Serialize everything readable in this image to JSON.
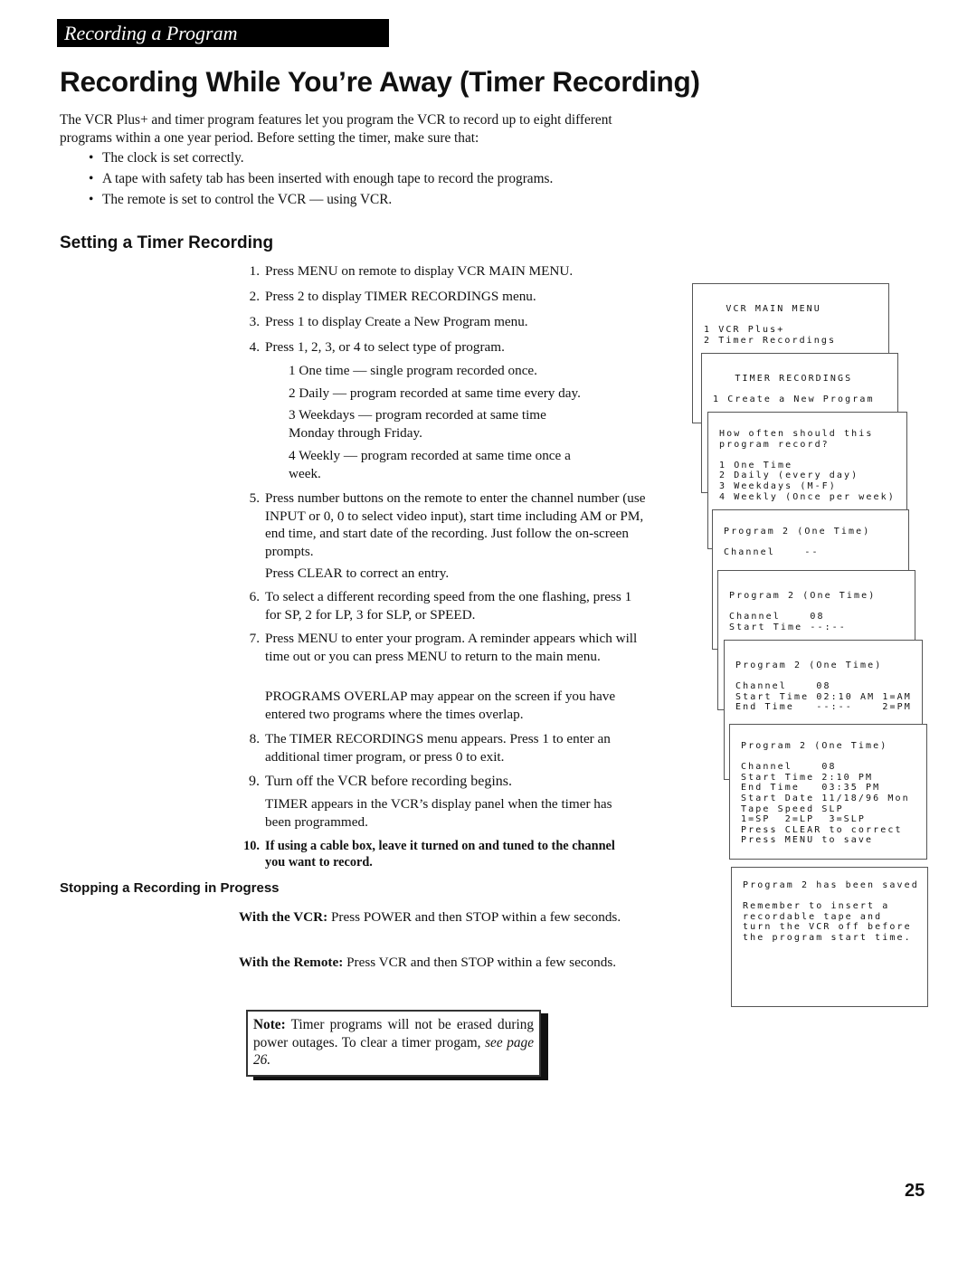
{
  "header": {
    "section": "Recording a Program",
    "title": "Recording While You’re Away (Timer Recording)"
  },
  "intro": {
    "text": "The VCR Plus+ and timer program features let you program the VCR to record up to eight different programs within a one year period.  Before setting the timer, make sure that:",
    "bullets": [
      "The clock is set correctly.",
      "A tape with safety tab has been inserted with enough tape to record the programs.",
      "The remote is set to control the VCR — using VCR."
    ]
  },
  "setting": {
    "heading": "Setting a Timer Recording",
    "steps": [
      {
        "n": "1.",
        "text": "Press MENU on remote to display VCR MAIN MENU."
      },
      {
        "n": "2.",
        "text": "Press 2 to display TIMER RECORDINGS menu."
      },
      {
        "n": "3.",
        "text": "Press 1 to display Create a New Program menu."
      },
      {
        "n": "4.",
        "text": "Press 1, 2, 3, or 4 to select type of program."
      },
      {
        "n": "5.",
        "text": "Press number buttons on the remote to enter the channel number (use INPUT or 0, 0 to select video input), start time including AM or PM, end time, and start date of the recording.  Just follow the on-screen prompts."
      },
      {
        "n": "6.",
        "text": "To select a different recording speed from the one flashing, press 1 for SP, 2 for LP, 3 for SLP, or SPEED."
      },
      {
        "n": "7.",
        "text": "Press MENU to enter your program.  A reminder appears which will time out or you can press MENU to return to the main menu."
      },
      {
        "n": "8.",
        "text": "The TIMER RECORDINGS menu appears.  Press 1 to enter an additional timer program, or press 0 to exit."
      },
      {
        "n": "9.",
        "text": "Turn off the VCR before recording begins."
      },
      {
        "n": "10.",
        "text": "If using a cable box, leave it turned on and tuned to the channel you want to record."
      }
    ],
    "types": [
      "1 One time — single program recorded once.",
      "2 Daily — program recorded at same time every day.",
      "3 Weekdays — program recorded at same time Monday through Friday.",
      "4 Weekly — program recorded at same time once a week."
    ],
    "step5_extra": "Press CLEAR to correct an entry.",
    "step7_extra": "PROGRAMS OVERLAP may appear on the screen if you have entered two programs where the times overlap.",
    "step9_extra": "TIMER appears in the VCR’s display panel when the timer has been programmed."
  },
  "stopping": {
    "heading": "Stopping a Recording in Progress",
    "vcr_label": "With the VCR:",
    "vcr_text": "Press POWER and then STOP within a few seconds.",
    "remote_label": "With the Remote:",
    "remote_text": "Press VCR and then STOP within a few seconds."
  },
  "note": {
    "label": "Note:",
    "text": "Timer programs will not be erased during power outages.  To clear a timer progam,",
    "ref": "see page 26."
  },
  "screens": [
    {
      "lines": [
        "   VCR MAIN MENU",
        "",
        "1 VCR Plus+",
        "2 Timer Recordings"
      ]
    },
    {
      "lines": [
        "   TIMER RECORDINGS",
        "",
        "1 Create a New Program"
      ]
    },
    {
      "lines": [
        "How often should this",
        "program record?",
        "",
        "1 One Time",
        "2 Daily (every day)",
        "3 Weekdays (M-F)",
        "4 Weekly (Once per week)"
      ]
    },
    {
      "lines": [
        "Program 2 (One Time)",
        "",
        "Channel    --"
      ]
    },
    {
      "lines": [
        "Program 2 (One Time)",
        "",
        "Channel    08",
        "Start Time --:--"
      ]
    },
    {
      "lines": [
        "Program 2 (One Time)",
        "",
        "Channel    08",
        "Start Time 02:10 AM 1=AM",
        "End Time   --:--    2=PM"
      ]
    },
    {
      "lines": [
        "Program 2 (One Time)",
        "",
        "Channel    08",
        "Start Time 2:10 PM",
        "End Time   03:35 PM",
        "Start Date 11/18/96 Mon",
        "Tape Speed SLP",
        "1=SP  2=LP  3=SLP",
        "Press CLEAR to correct",
        "Press MENU to save"
      ]
    },
    {
      "lines": [
        "Program 2 has been saved",
        "",
        "Remember to insert a",
        "recordable tape and",
        "turn the VCR off before",
        "the program start time."
      ]
    }
  ],
  "page_number": "25"
}
